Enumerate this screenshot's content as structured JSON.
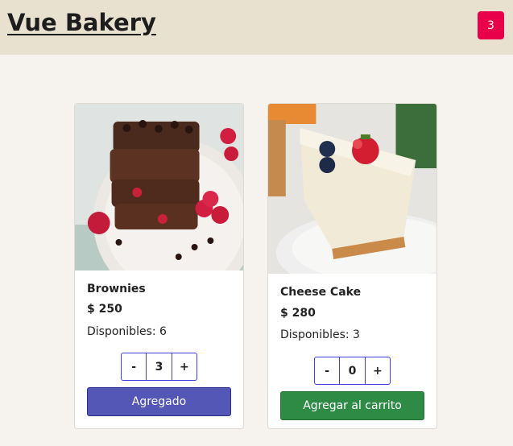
{
  "header": {
    "brand": "Vue Bakery",
    "cart_count": "3"
  },
  "colors": {
    "header_bg": "#e9e1d0",
    "page_bg": "#f6f3ee",
    "badge": "#e8004a",
    "added_button": "#5457b6",
    "add_button": "#2e8b46",
    "stepper_border": "#3f3fd9"
  },
  "products": [
    {
      "name": "Brownies",
      "price": "$ 250",
      "stock": "Disponibles: 6",
      "quantity": "3",
      "minus": "-",
      "plus": "+",
      "action": "Agregado"
    },
    {
      "name": "Cheese Cake",
      "price": "$ 280",
      "stock": "Disponibles: 3",
      "quantity": "0",
      "minus": "-",
      "plus": "+",
      "action": "Agregar al carrito"
    }
  ]
}
